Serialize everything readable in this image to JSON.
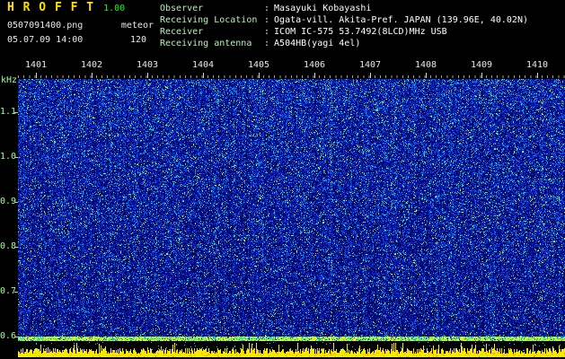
{
  "app": {
    "title": "H R O F F T",
    "version": "1.00",
    "filename": "0507091400.png",
    "mode_label": "meteor",
    "datetime": "05.07.09 14:00",
    "sample_count": "120"
  },
  "info": {
    "colon": ":",
    "rows": [
      {
        "label": "Observer",
        "value": "Masayuki Kobayashi"
      },
      {
        "label": "Receiving Location",
        "value": "Ogata-vill. Akita-Pref. JAPAN (139.96E, 40.02N)"
      },
      {
        "label": "Receiver",
        "value": "ICOM IC-575 53.7492(8LCD)MHz USB"
      },
      {
        "label": "Receiving antenna",
        "value": "A504HB(yagi 4el)"
      }
    ]
  },
  "chart_data": {
    "type": "heatmap",
    "title": "HROFFT radio meteor observation spectrogram",
    "x_axis": {
      "unit": "time (hhmm)",
      "ticks": [
        "1401",
        "1402",
        "1403",
        "1404",
        "1405",
        "1406",
        "1407",
        "1408",
        "1409",
        "1410"
      ]
    },
    "y_axis": {
      "label": "kHz",
      "ticks": [
        "1.1",
        "1.0",
        "0.9",
        "0.8",
        "0.7",
        "0.6"
      ],
      "range_khz": [
        0.59,
        1.175
      ]
    },
    "grid": "off",
    "legend": "off",
    "content_summary": "broadband blue receiver-noise field with cyan/green/yellow speckle, denser bright speckle toward top, bright yellow-green band at bottom edge, yellow signal-level strip below",
    "noise": {
      "seed": 20050709,
      "palette": [
        "#01034a",
        "#03077d",
        "#0713ad",
        "#0b2fd6",
        "#0a64f0",
        "#00b9f0",
        "#28ff96",
        "#b4ff00",
        "#ffee00"
      ],
      "thresholds": [
        0.22,
        0.42,
        0.64,
        0.8,
        0.91,
        0.955,
        0.975,
        0.995
      ],
      "band_palette": [
        "#ffee00",
        "#c8ff00",
        "#00ffb4",
        "#00a0ff",
        "#0828c8"
      ],
      "band_thresholds": [
        0.35,
        0.6,
        0.8,
        0.92
      ]
    },
    "level_graph": {
      "bar_colors": [
        "#ffe600",
        "#c8ff00",
        "#ff9600"
      ],
      "speckle_color": "#00d2ff",
      "background": "#000000"
    },
    "colors": {
      "title": "#ffe000",
      "version": "#00ff00",
      "axis_text": "#9fff9f",
      "header_text": "#e8e8e8",
      "tick": "#c8c8c8"
    }
  }
}
